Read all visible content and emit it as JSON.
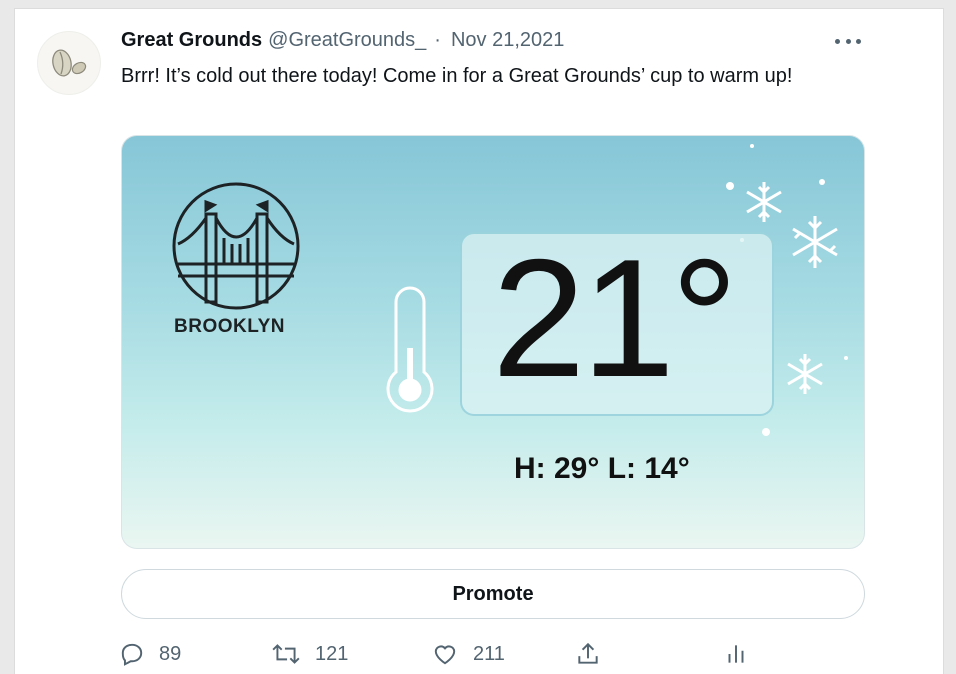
{
  "tweet": {
    "display_name": "Great Grounds",
    "handle": "@GreatGrounds_",
    "separator": "·",
    "date": "Nov 21,2021",
    "text": "Brrr! It’s cold out there today! Come in for a Great Grounds’ cup to warm up!",
    "avatar_icon": "coffee-bean-logo"
  },
  "media": {
    "city": "BROOKLYN",
    "temperature": "21°",
    "high_low": "H: 29°  L: 14°",
    "icons": [
      "bridge-icon",
      "thermometer-icon",
      "snowflake-icon"
    ],
    "colors": {
      "top": "#86c6d7",
      "bottom": "#eaf6f1",
      "box_border": "#96d0dc"
    }
  },
  "promote_label": "Promote",
  "actions": {
    "replies": "89",
    "retweets": "121",
    "likes": "211",
    "icons": [
      "reply-icon",
      "retweet-icon",
      "like-icon",
      "share-icon",
      "analytics-icon"
    ]
  },
  "colors": {
    "text": "#0f1419",
    "secondary": "#536471",
    "border": "#cfd9de"
  }
}
